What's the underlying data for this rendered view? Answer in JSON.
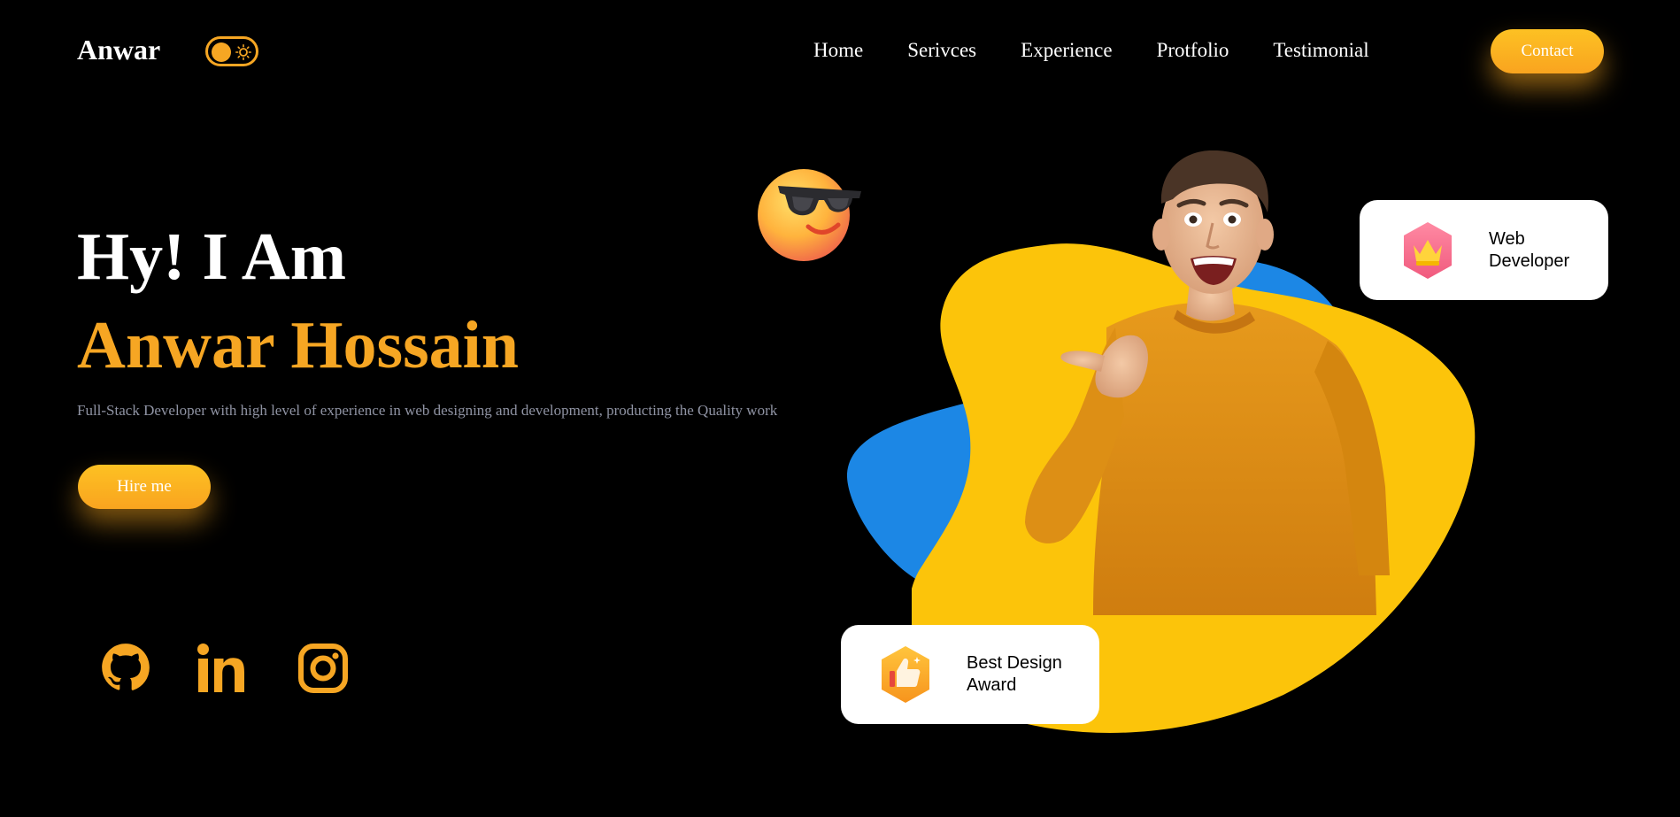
{
  "header": {
    "logo": "Anwar",
    "nav": [
      {
        "label": "Home"
      },
      {
        "label": "Serivces"
      },
      {
        "label": "Experience"
      },
      {
        "label": "Protfolio"
      },
      {
        "label": "Testimonial"
      }
    ],
    "contact_label": "Contact"
  },
  "hero": {
    "greeting": "Hy! I Am",
    "name": "Anwar Hossain",
    "description": "Full-Stack Developer with high level of experience in web designing and development, producting the Quality work",
    "hire_label": "Hire me"
  },
  "social": [
    {
      "icon": "github-icon"
    },
    {
      "icon": "linkedin-icon"
    },
    {
      "icon": "instagram-icon"
    }
  ],
  "badges": {
    "web": {
      "icon": "crown-icon",
      "line1": "Web",
      "line2": "Developer"
    },
    "award": {
      "icon": "thumbs-up-icon",
      "line1": "Best Design",
      "line2": "Award"
    }
  },
  "colors": {
    "accent": "#f6a623",
    "blob_yellow": "#fcc40a",
    "blob_blue": "#1c87e5",
    "background": "#000000",
    "muted_text": "#8f93a3"
  }
}
